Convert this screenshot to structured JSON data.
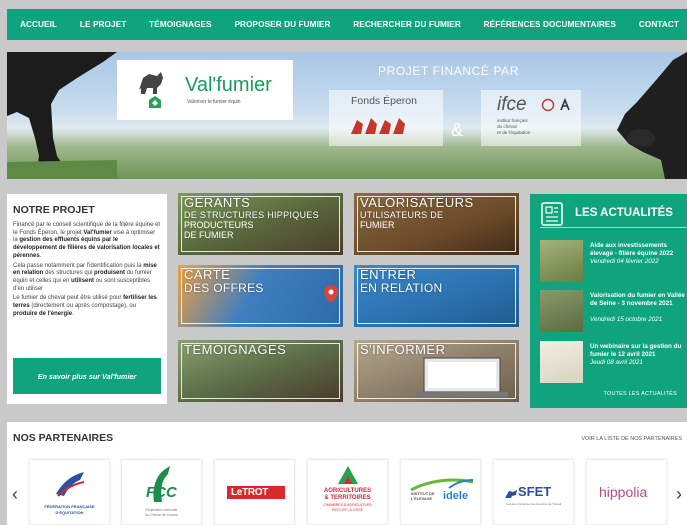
{
  "nav": {
    "items": [
      "ACCUEIL",
      "LE PROJET",
      "TÉMOIGNAGES",
      "PROPOSER DU FUMIER",
      "RECHERCHER DU FUMIER",
      "RÉFÉRENCES DOCUMENTAIRES",
      "CONTACT"
    ]
  },
  "hero": {
    "logo_name": "Val'fumier",
    "logo_tagline": "Valoriser le fumier équin",
    "banner_title": "PROJET FINANCÉ PAR",
    "fonds": "Fonds Éperon",
    "ifce": "ifce",
    "ifce_sub": [
      "institut français",
      "du cheval",
      "et de l'équitation"
    ],
    "amp": "&"
  },
  "projet": {
    "title": "NOTRE PROJET",
    "p1_a": "Financé par le conseil scientifique de la filière équine et le Fonds Éperon, le projet ",
    "p1_b": "Val'fumier",
    "p1_c": " vise à optimiser la ",
    "p1_d": "gestion des effluents équins par le développement de filières de valorisation locales et pérennes",
    "p1_e": ".",
    "p2_a": "Cela passe notamment par l'identification puis la ",
    "p2_b": "mise en relation",
    "p2_c": " des structures qui ",
    "p2_d": "produisent",
    "p2_e": " du fumier équin et celles qui en ",
    "p2_f": "utilisent",
    "p2_g": " ou sont susceptibles d'en utiliser",
    "p3_a": "Le fumier de cheval peut être utilisé pour ",
    "p3_b": "fertiliser les terres",
    "p3_c": " (directement ou après compostage), ou ",
    "p3_d": "produire de l'énergie",
    "p3_e": ".",
    "button": "En savoir plus sur Val'fumier"
  },
  "tiles": {
    "gerants": [
      "GÉRANTS",
      "DE STRUCTURES HIPPIQUES",
      "PRODUCTEURS",
      "DE FUMIER"
    ],
    "valorisateurs": [
      "VALORISATEURS",
      "UTILISATEURS DE",
      "FUMIER"
    ],
    "carte": [
      "CARTE",
      "DES OFFRES"
    ],
    "entrer": [
      "ENTRER",
      "EN RELATION"
    ],
    "temoignages": [
      "TÉMOIGNAGES"
    ],
    "informer": [
      "S'INFORMER"
    ]
  },
  "actu": {
    "title": "LES ACTUALITÉS",
    "news": [
      {
        "title": "Aide aux investissements élevage - filière équine 2022",
        "date": "Vendredi 04 février 2022"
      },
      {
        "title": "Valorisation du fumier en Vallée de Seine - 3 novembre 2021",
        "date": "Vendredi 15 octobre 2021"
      },
      {
        "title": "Un webinaire sur la gestion du fumier le 12 avril 2021",
        "date": "Jeudi 08 avril 2021"
      }
    ],
    "all_link": "TOUTES LES ACTUALITÉS"
  },
  "partners": {
    "title": "NOS PARTENAIRES",
    "link": "VOIR LA LISTE DE NOS PARTENAIRES",
    "logos": [
      {
        "name": "ffe",
        "lines": [
          "FÉDÉRATION FRANÇAISE",
          "D'ÉQUITATION"
        ]
      },
      {
        "name": "fcc",
        "lines": [
          "FCC",
          "Fédération nationale",
          "du Cheval de Course"
        ]
      },
      {
        "name": "letrot",
        "lines": [
          "LeTROT"
        ]
      },
      {
        "name": "chambre",
        "lines": [
          "AGRICULTURES",
          "& TERRITOIRES",
          "CHAMBRES D'AGRICULTURE",
          "PAYS DE LA LOIRE"
        ]
      },
      {
        "name": "idele",
        "lines": [
          "INSTITUT DE",
          "L'ÉLEVAGE",
          "idele"
        ]
      },
      {
        "name": "sfet",
        "lines": [
          "SFET",
          "Société Française des Équidés de Travail"
        ]
      },
      {
        "name": "hippolia",
        "lines": [
          "hippolia"
        ]
      }
    ],
    "prev": "‹",
    "next": "›"
  },
  "colors": {
    "accent": "#0fa47d",
    "background": "#c9c9c9"
  }
}
